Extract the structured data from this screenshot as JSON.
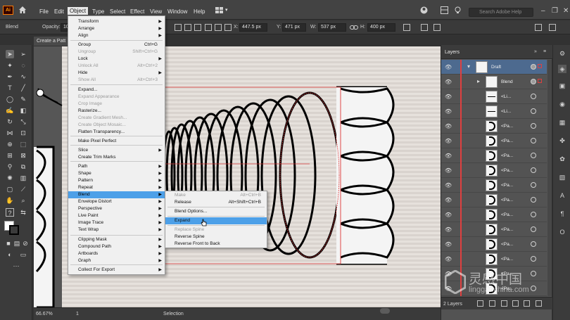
{
  "app": {
    "logo": "Ai"
  },
  "menubar": {
    "items": [
      "File",
      "Edit",
      "Object",
      "Type",
      "Select",
      "Effect",
      "View",
      "Window",
      "Help"
    ],
    "active": "Object",
    "search_placeholder": "Search Adobe Help"
  },
  "controlbar": {
    "selection": "Blend",
    "opacity_label": "Opacity:",
    "opacity_value": "10",
    "x_label": "X:",
    "x_value": "447.5 px",
    "y_label": "Y:",
    "y_value": "471 px",
    "w_label": "W:",
    "w_value": "537 px",
    "h_label": "H:",
    "h_value": "400 px"
  },
  "document": {
    "tab_title": "Create a Patt"
  },
  "object_menu": {
    "items": [
      {
        "label": "Transform",
        "submenu": true
      },
      {
        "label": "Arrange",
        "submenu": true
      },
      {
        "label": "Align",
        "submenu": true
      },
      {
        "label": "Group",
        "shortcut": "Ctrl+G"
      },
      {
        "label": "Ungroup",
        "shortcut": "Shift+Ctrl+G",
        "disabled": true
      },
      {
        "label": "Lock",
        "submenu": true
      },
      {
        "label": "Unlock All",
        "shortcut": "Alt+Ctrl+2",
        "disabled": true
      },
      {
        "label": "Hide",
        "submenu": true
      },
      {
        "label": "Show All",
        "shortcut": "Alt+Ctrl+3",
        "disabled": true
      },
      {
        "label": "Expand..."
      },
      {
        "label": "Expand Appearance",
        "disabled": true
      },
      {
        "label": "Crop Image",
        "disabled": true
      },
      {
        "label": "Rasterize..."
      },
      {
        "label": "Create Gradient Mesh...",
        "disabled": true
      },
      {
        "label": "Create Object Mosaic...",
        "disabled": true
      },
      {
        "label": "Flatten Transparency..."
      },
      {
        "label": "Make Pixel Perfect"
      },
      {
        "label": "Slice",
        "submenu": true
      },
      {
        "label": "Create Trim Marks"
      },
      {
        "label": "Path",
        "submenu": true
      },
      {
        "label": "Shape",
        "submenu": true
      },
      {
        "label": "Pattern",
        "submenu": true
      },
      {
        "label": "Repeat",
        "submenu": true
      },
      {
        "label": "Blend",
        "submenu": true,
        "highlight": true
      },
      {
        "label": "Envelope Distort",
        "submenu": true
      },
      {
        "label": "Perspective",
        "submenu": true
      },
      {
        "label": "Live Paint",
        "submenu": true
      },
      {
        "label": "Image Trace",
        "submenu": true
      },
      {
        "label": "Text Wrap",
        "submenu": true
      },
      {
        "label": "Clipping Mask",
        "submenu": true
      },
      {
        "label": "Compound Path",
        "submenu": true
      },
      {
        "label": "Artboards",
        "submenu": true
      },
      {
        "label": "Graph",
        "submenu": true
      },
      {
        "label": "Collect For Export",
        "submenu": true
      }
    ]
  },
  "blend_submenu": {
    "items": [
      {
        "label": "Make",
        "shortcut": "Alt+Ctrl+B",
        "disabled": true
      },
      {
        "label": "Release",
        "shortcut": "Alt+Shift+Ctrl+B"
      },
      {
        "label": "Blend Options..."
      },
      {
        "label": "Expand",
        "highlight": true
      },
      {
        "label": "Replace Spine",
        "disabled": true
      },
      {
        "label": "Reverse Spine"
      },
      {
        "label": "Reverse Front to Back"
      }
    ]
  },
  "status": {
    "zoom": "66.67%",
    "page": "1",
    "tool": "Selection"
  },
  "layers_panel": {
    "title": "Layers",
    "rows": [
      {
        "name": "Draft",
        "active": true
      },
      {
        "name": "Blend"
      },
      {
        "name": "<Li..."
      },
      {
        "name": "<Li..."
      },
      {
        "name": "<Pa..."
      },
      {
        "name": "<Pa..."
      },
      {
        "name": "<Pa..."
      },
      {
        "name": "<Pa..."
      },
      {
        "name": "<Pa..."
      },
      {
        "name": "<Pa..."
      },
      {
        "name": "<Pa..."
      },
      {
        "name": "<Pa..."
      },
      {
        "name": "<Pa..."
      },
      {
        "name": "<Pa..."
      },
      {
        "name": "<Pa..."
      },
      {
        "name": "<Pa..."
      }
    ],
    "footer": "2 Layers"
  },
  "watermark": {
    "text": "灵感中国",
    "sub": "lingganchina.com"
  },
  "colors": {
    "accent": "#4da0e8",
    "layer_color": "#e04040",
    "selection_row": "#4d6a8f"
  }
}
